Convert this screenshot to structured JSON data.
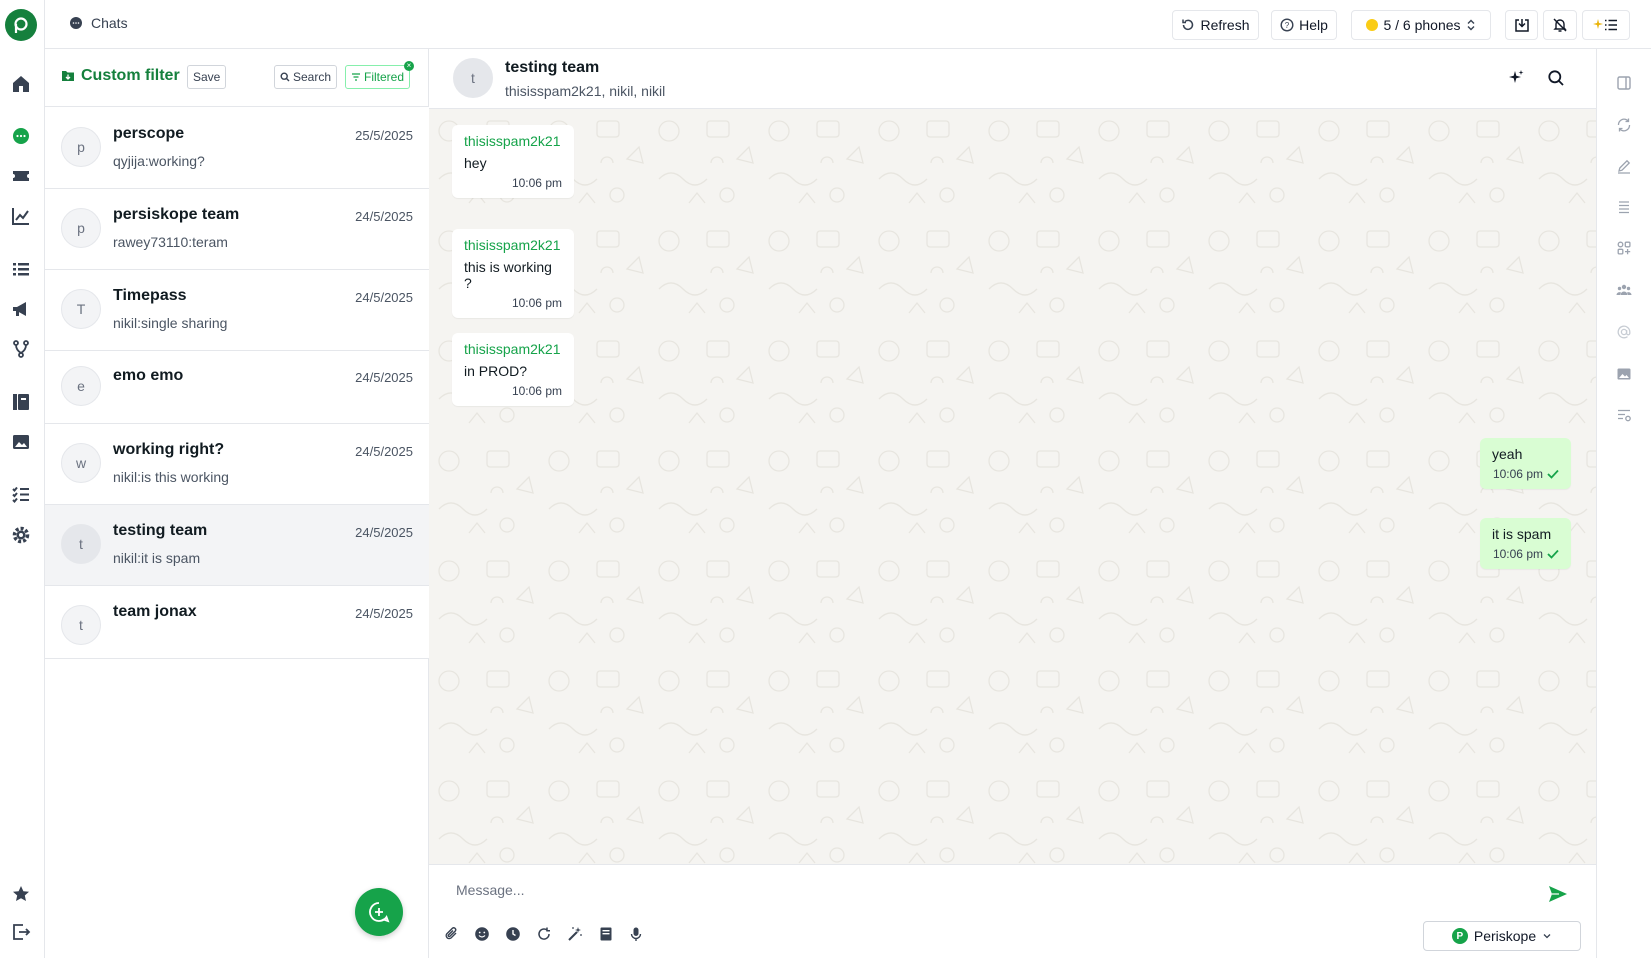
{
  "topbar": {
    "section_label": "Chats",
    "refresh_label": "Refresh",
    "help_label": "Help",
    "phones_label": "5 / 6 phones"
  },
  "filter": {
    "title": "Custom filter",
    "save_label": "Save",
    "search_label": "Search",
    "filtered_label": "Filtered"
  },
  "chats": [
    {
      "initial": "p",
      "name": "perscope",
      "date": "25/5/2025",
      "preview": "qyjija:working?"
    },
    {
      "initial": "p",
      "name": "persiskope team",
      "date": "24/5/2025",
      "preview": "rawey73110:teram"
    },
    {
      "initial": "T",
      "name": "Timepass",
      "date": "24/5/2025",
      "preview": "nikil:single sharing"
    },
    {
      "initial": "e",
      "name": "emo emo",
      "date": "24/5/2025",
      "preview": ""
    },
    {
      "initial": "w",
      "name": "working right?",
      "date": "24/5/2025",
      "preview": "nikil:is this working"
    },
    {
      "initial": "t",
      "name": "testing team",
      "date": "24/5/2025",
      "preview": "nikil:it is spam"
    },
    {
      "initial": "t",
      "name": "team jonax",
      "date": "24/5/2025",
      "preview": ""
    }
  ],
  "conversation": {
    "initial": "t",
    "title": "testing team",
    "members": "thisisspam2k21, nikil, nikil",
    "messages": [
      {
        "direction": "in",
        "sender": "thisisspam2k21",
        "text": "hey",
        "time": "10:06 pm"
      },
      {
        "direction": "in",
        "sender": "thisisspam2k21",
        "text": "this is working ?",
        "time": "10:06 pm"
      },
      {
        "direction": "in",
        "sender": "thisisspam2k21",
        "text": "in PROD?",
        "time": "10:06 pm"
      },
      {
        "direction": "out",
        "sender": "",
        "text": "yeah",
        "time": "10:06 pm"
      },
      {
        "direction": "out",
        "sender": "",
        "text": "it is spam",
        "time": "10:06 pm"
      }
    ]
  },
  "composer": {
    "placeholder": "Message...",
    "account_label": "Periskope",
    "account_initial": "P"
  },
  "colors": {
    "brand_green": "#16a34a",
    "outgoing_bubble": "#d9fdd3",
    "chat_background": "#f5f4f1",
    "selected_row": "#f3f4f6"
  }
}
